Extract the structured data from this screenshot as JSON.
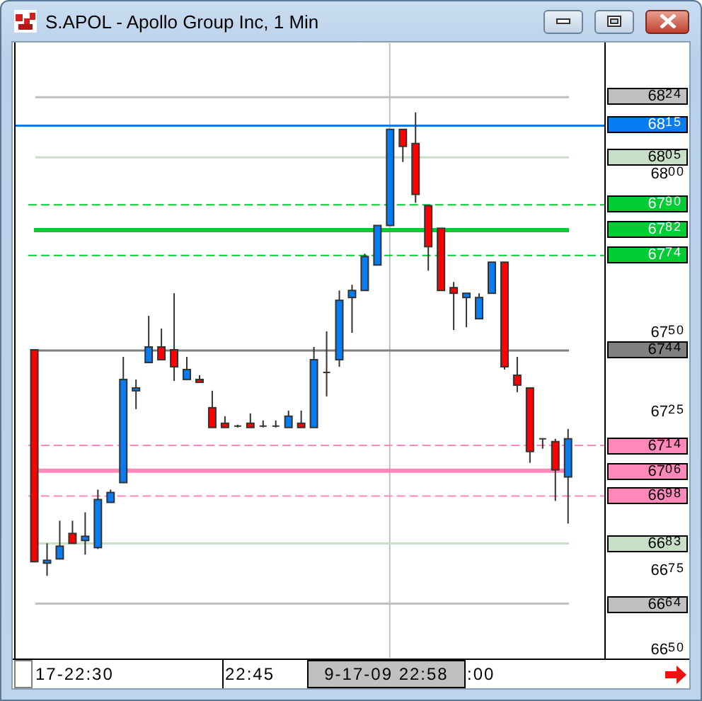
{
  "window": {
    "title": "S.APOL - Apollo Group Inc, 1 Min"
  },
  "chart": {
    "price_markers": [
      {
        "text": "68$^{24}$",
        "color": "#c0c0c0",
        "kind": "solid"
      },
      {
        "text": "68$^{15}$",
        "color": "#0a7cf2",
        "kind": "full"
      },
      {
        "text": "68$^{05}$",
        "color": "#c6dfc6",
        "kind": "solid"
      },
      {
        "text": "67$^{90}$",
        "color": "#00cc33",
        "kind": "dashed"
      },
      {
        "text": "67$^{82}$",
        "color": "#00cc33",
        "kind": "thick"
      },
      {
        "text": "67$^{74}$",
        "color": "#00cc33",
        "kind": "dashed"
      },
      {
        "text": "67$^{44}$",
        "color": "#808080",
        "kind": "solid"
      },
      {
        "text": "67$^{14}$",
        "color": "#ff88bb",
        "kind": "dashed"
      },
      {
        "text": "67$^{06}$",
        "color": "#ff88bb",
        "kind": "thick"
      },
      {
        "text": "66$^{98}$",
        "color": "#ff88bb",
        "kind": "dashed"
      },
      {
        "text": "66$^{83}$",
        "color": "#c6dfc6",
        "kind": "solid"
      },
      {
        "text": "66$^{64}$",
        "color": "#c0c0c0",
        "kind": "solid"
      }
    ],
    "price_ticks": [
      "68$^{00}$",
      "67$^{50}$",
      "67$^{25}$",
      "66$^{75}$",
      "66$^{50}$"
    ],
    "time_labels": [
      "17-22:30",
      "22:45"
    ],
    "cursor_time": "9-17-09 22:58",
    "time_label_after_cursor": ":00"
  }
}
